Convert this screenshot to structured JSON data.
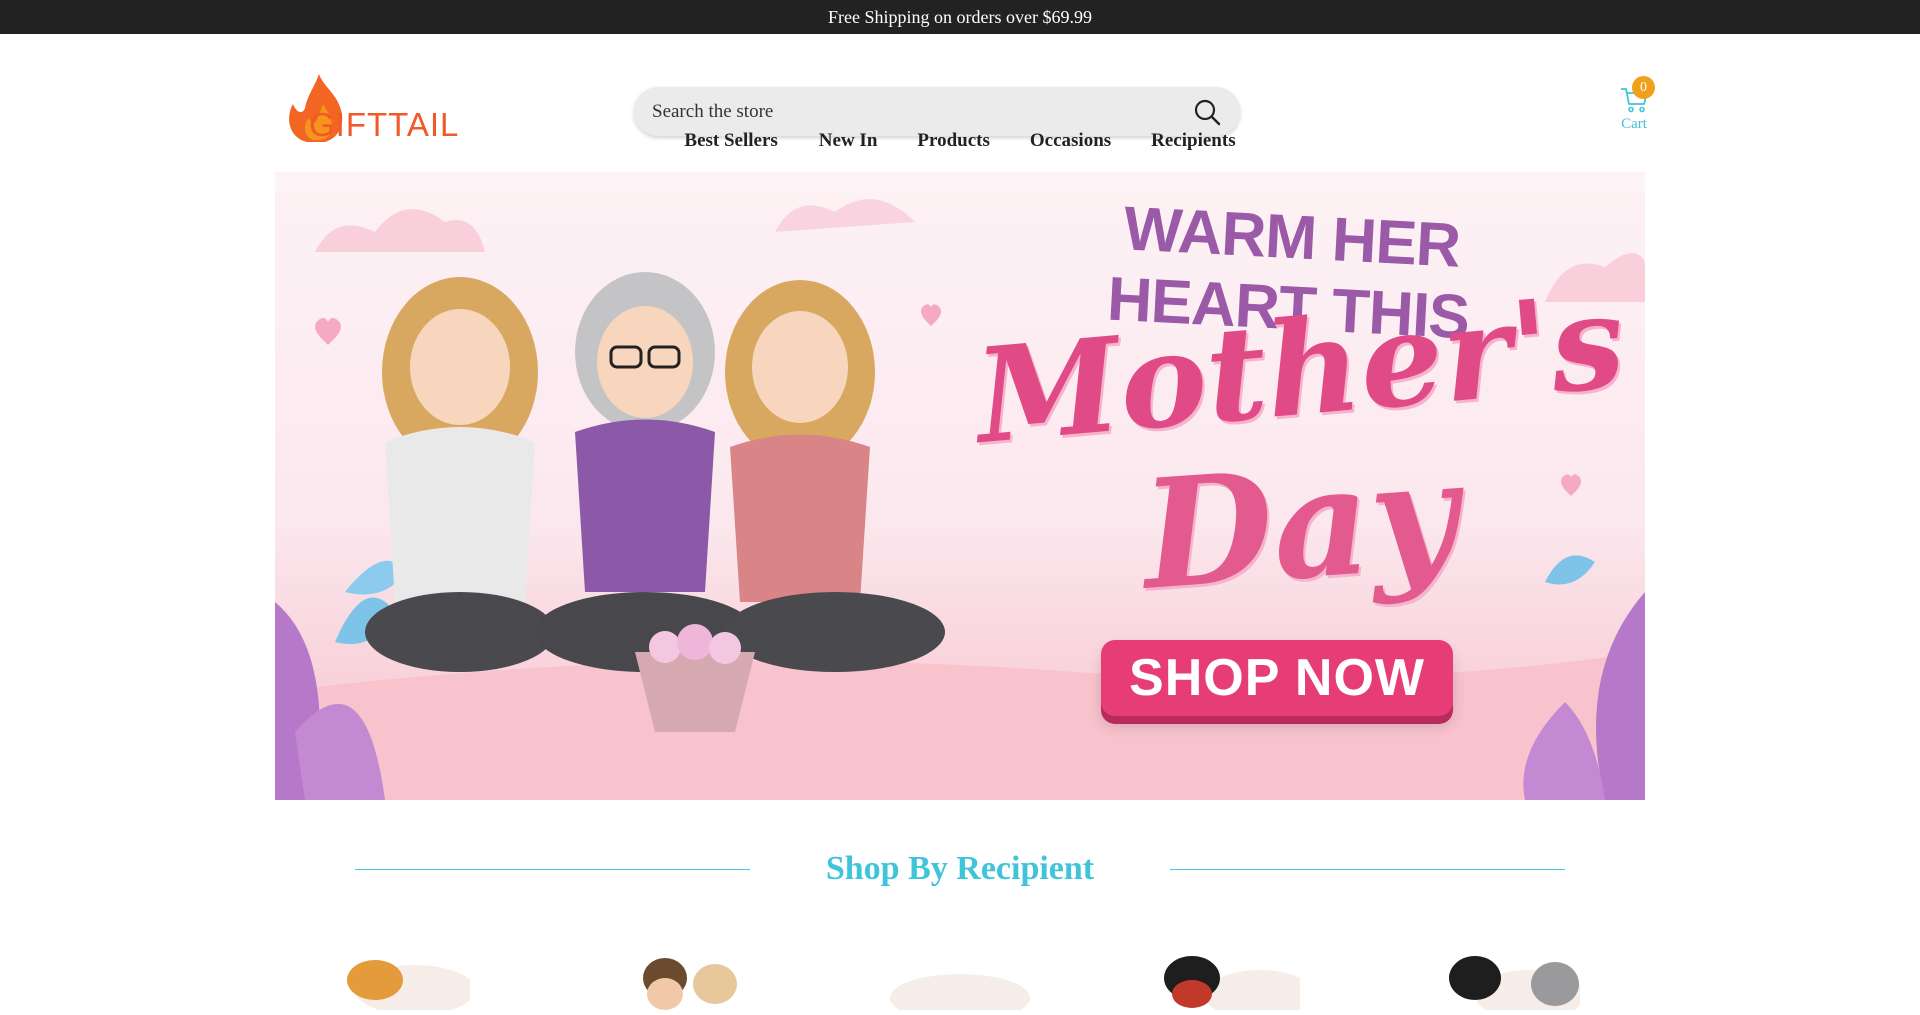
{
  "announcement": {
    "text": "Free Shipping on orders over $69.99"
  },
  "logo": {
    "text": "GIFTTAIL"
  },
  "search": {
    "placeholder": "Search the store"
  },
  "cart": {
    "count": "0",
    "label": "Cart"
  },
  "nav": {
    "items": [
      {
        "label": "Best Sellers",
        "caret": ""
      },
      {
        "label": "New In"
      },
      {
        "label": "Products"
      },
      {
        "label": "Occasions"
      },
      {
        "label": "Recipients"
      }
    ]
  },
  "hero": {
    "line1": "WARM HER HEART THIS",
    "line2": "Mother's",
    "line3": "Day",
    "button": "SHOP NOW"
  },
  "section": {
    "title": "Shop By Recipient"
  },
  "colors": {
    "accent": "#3fc4d9",
    "brand": "#f05a28",
    "badge": "#f0a11c",
    "hero_button": "#e63d77"
  },
  "icons": {
    "search": "search-icon",
    "cart": "cart-icon",
    "logo_flame": "flame-icon"
  }
}
